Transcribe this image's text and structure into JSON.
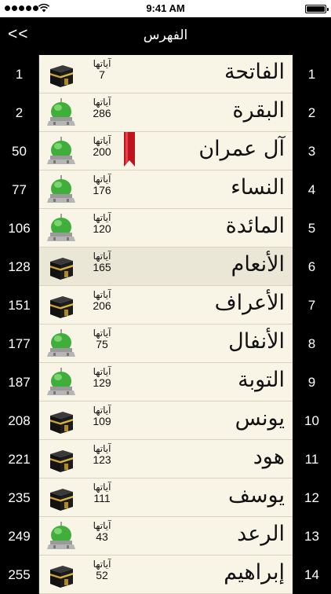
{
  "status": {
    "time": "9:41 AM"
  },
  "nav": {
    "back_label": "<<",
    "title": "الفهرس"
  },
  "rows": [
    {
      "page": "1",
      "number": "1",
      "name": "الفاتحة",
      "ayat_label": "آياتها",
      "ayat": "7",
      "icon": "kaaba-icon"
    },
    {
      "page": "2",
      "number": "2",
      "name": "البقرة",
      "ayat_label": "آياتها",
      "ayat": "286",
      "icon": "mosque-dome-icon"
    },
    {
      "page": "50",
      "number": "3",
      "name": "آل عمران",
      "ayat_label": "آياتها",
      "ayat": "200",
      "icon": "mosque-dome-icon",
      "bookmark": true
    },
    {
      "page": "77",
      "number": "4",
      "name": "النساء",
      "ayat_label": "آياتها",
      "ayat": "176",
      "icon": "mosque-dome-icon"
    },
    {
      "page": "106",
      "number": "5",
      "name": "المائدة",
      "ayat_label": "آياتها",
      "ayat": "120",
      "icon": "mosque-dome-icon"
    },
    {
      "page": "128",
      "number": "6",
      "name": "الأنعام",
      "ayat_label": "آياتها",
      "ayat": "165",
      "icon": "kaaba-icon",
      "selected": true
    },
    {
      "page": "151",
      "number": "7",
      "name": "الأعراف",
      "ayat_label": "آياتها",
      "ayat": "206",
      "icon": "kaaba-icon"
    },
    {
      "page": "177",
      "number": "8",
      "name": "الأنفال",
      "ayat_label": "آياتها",
      "ayat": "75",
      "icon": "mosque-dome-icon"
    },
    {
      "page": "187",
      "number": "9",
      "name": "التوبة",
      "ayat_label": "آياتها",
      "ayat": "129",
      "icon": "mosque-dome-icon"
    },
    {
      "page": "208",
      "number": "10",
      "name": "يونس",
      "ayat_label": "آياتها",
      "ayat": "109",
      "icon": "kaaba-icon"
    },
    {
      "page": "221",
      "number": "11",
      "name": "هود",
      "ayat_label": "آياتها",
      "ayat": "123",
      "icon": "kaaba-icon"
    },
    {
      "page": "235",
      "number": "12",
      "name": "يوسف",
      "ayat_label": "آياتها",
      "ayat": "111",
      "icon": "kaaba-icon"
    },
    {
      "page": "249",
      "number": "13",
      "name": "الرعد",
      "ayat_label": "آياتها",
      "ayat": "43",
      "icon": "mosque-dome-icon"
    },
    {
      "page": "255",
      "number": "14",
      "name": "إبراهيم",
      "ayat_label": "آياتها",
      "ayat": "52",
      "icon": "kaaba-icon"
    }
  ],
  "colors": {
    "content_bg": "#f9f5e6",
    "selected_bg": "#ebe7d6",
    "ribbon": "#c0141c",
    "dome": "#3fae3a"
  }
}
